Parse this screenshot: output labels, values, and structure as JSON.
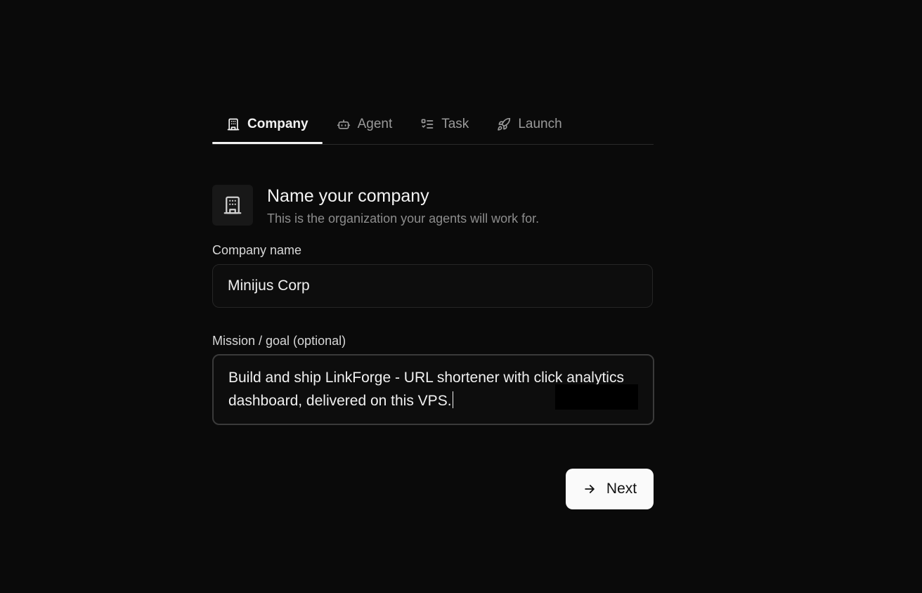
{
  "tabs": [
    {
      "label": "Company",
      "icon": "building-icon",
      "active": true
    },
    {
      "label": "Agent",
      "icon": "bot-icon",
      "active": false
    },
    {
      "label": "Task",
      "icon": "list-check-icon",
      "active": false
    },
    {
      "label": "Launch",
      "icon": "rocket-icon",
      "active": false
    }
  ],
  "header": {
    "icon": "building-icon",
    "title": "Name your company",
    "subtitle": "This is the organization your agents will work for."
  },
  "company_field": {
    "label": "Company name",
    "value": "Minijus Corp"
  },
  "mission_field": {
    "label": "Mission / goal (optional)",
    "value": "Build and ship LinkForge - URL shortener with click analytics dashboard, delivered on this VPS."
  },
  "next_button": {
    "label": "Next",
    "icon": "arrow-right-icon"
  },
  "colors": {
    "background": "#0a0a0a",
    "text": "#ececec",
    "muted": "#8d8d8d",
    "button_bg": "#fafafa"
  }
}
